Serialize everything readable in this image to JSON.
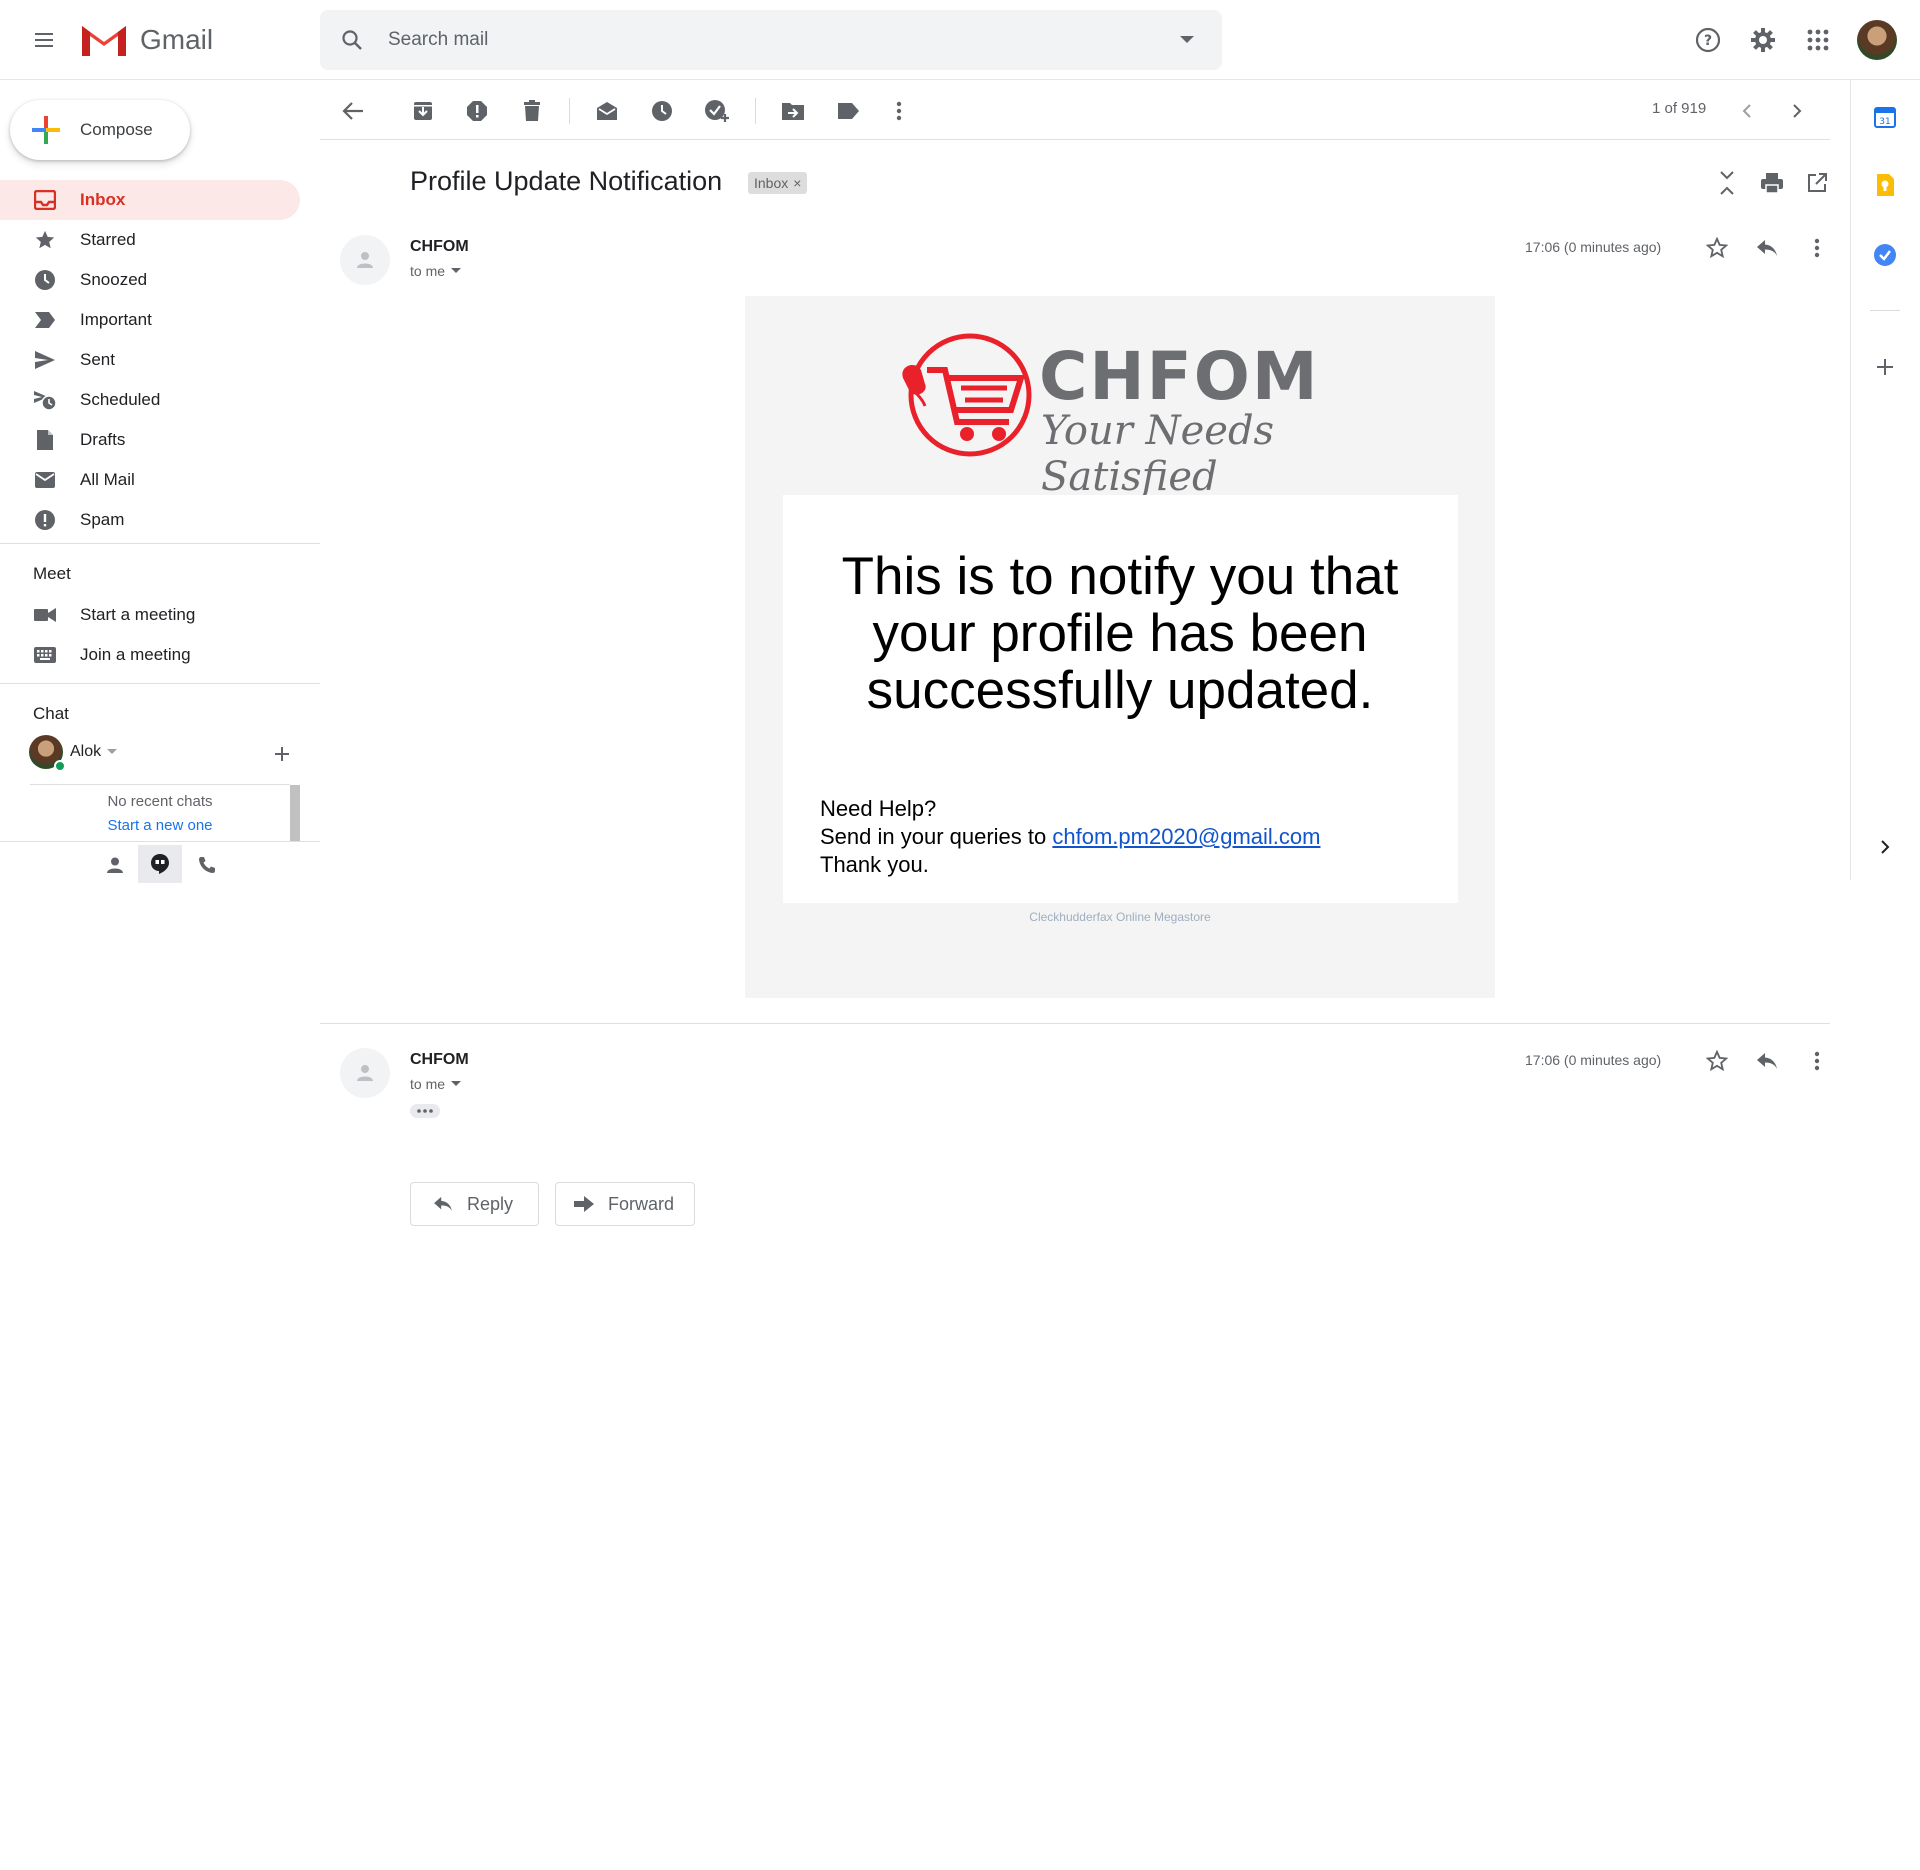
{
  "header": {
    "app_name": "Gmail",
    "search_placeholder": "Search mail",
    "icons": [
      "menu-icon",
      "help-icon",
      "settings-icon",
      "apps-icon"
    ]
  },
  "sidebar": {
    "compose_label": "Compose",
    "items": [
      {
        "label": "Inbox",
        "icon": "inbox-icon",
        "active": true
      },
      {
        "label": "Starred",
        "icon": "star-icon"
      },
      {
        "label": "Snoozed",
        "icon": "clock-icon"
      },
      {
        "label": "Important",
        "icon": "important-icon"
      },
      {
        "label": "Sent",
        "icon": "send-icon"
      },
      {
        "label": "Scheduled",
        "icon": "scheduled-icon"
      },
      {
        "label": "Drafts",
        "icon": "draft-icon"
      },
      {
        "label": "All Mail",
        "icon": "mail-icon"
      },
      {
        "label": "Spam",
        "icon": "spam-icon"
      }
    ],
    "meet": {
      "title": "Meet",
      "items": [
        {
          "label": "Start a meeting",
          "icon": "video-icon"
        },
        {
          "label": "Join a meeting",
          "icon": "keyboard-icon"
        }
      ]
    },
    "chat": {
      "title": "Chat",
      "user": "Alok",
      "no_recent": "No recent chats",
      "start_new": "Start a new one"
    }
  },
  "toolbar": {
    "paging": "1 of 919"
  },
  "thread": {
    "subject": "Profile Update Notification",
    "label_chip": "Inbox",
    "messages": [
      {
        "sender": "CHFOM",
        "to": "to me",
        "time": "17:06 (0 minutes ago)"
      },
      {
        "sender": "CHFOM",
        "to": "to me",
        "time": "17:06 (0 minutes ago)"
      }
    ]
  },
  "email_body": {
    "brand_name": "CHFOM",
    "brand_tagline": "Your Needs Satisfied",
    "headline": "This is to notify you that your profile has been successfully updated.",
    "help_title": "Need Help?",
    "help_prefix": "Send in your queries to ",
    "help_email": "chfom.pm2020@gmail.com",
    "thanks": "Thank you.",
    "footer": "Cleckhudderfax Online Megastore"
  },
  "actions": {
    "reply_label": "Reply",
    "forward_label": "Forward"
  },
  "colors": {
    "accent_red": "#d93025",
    "active_bg": "#fce8e6",
    "link_blue": "#1155cc",
    "brand_red": "#e8212a",
    "brand_gray": "#6d6e71"
  }
}
